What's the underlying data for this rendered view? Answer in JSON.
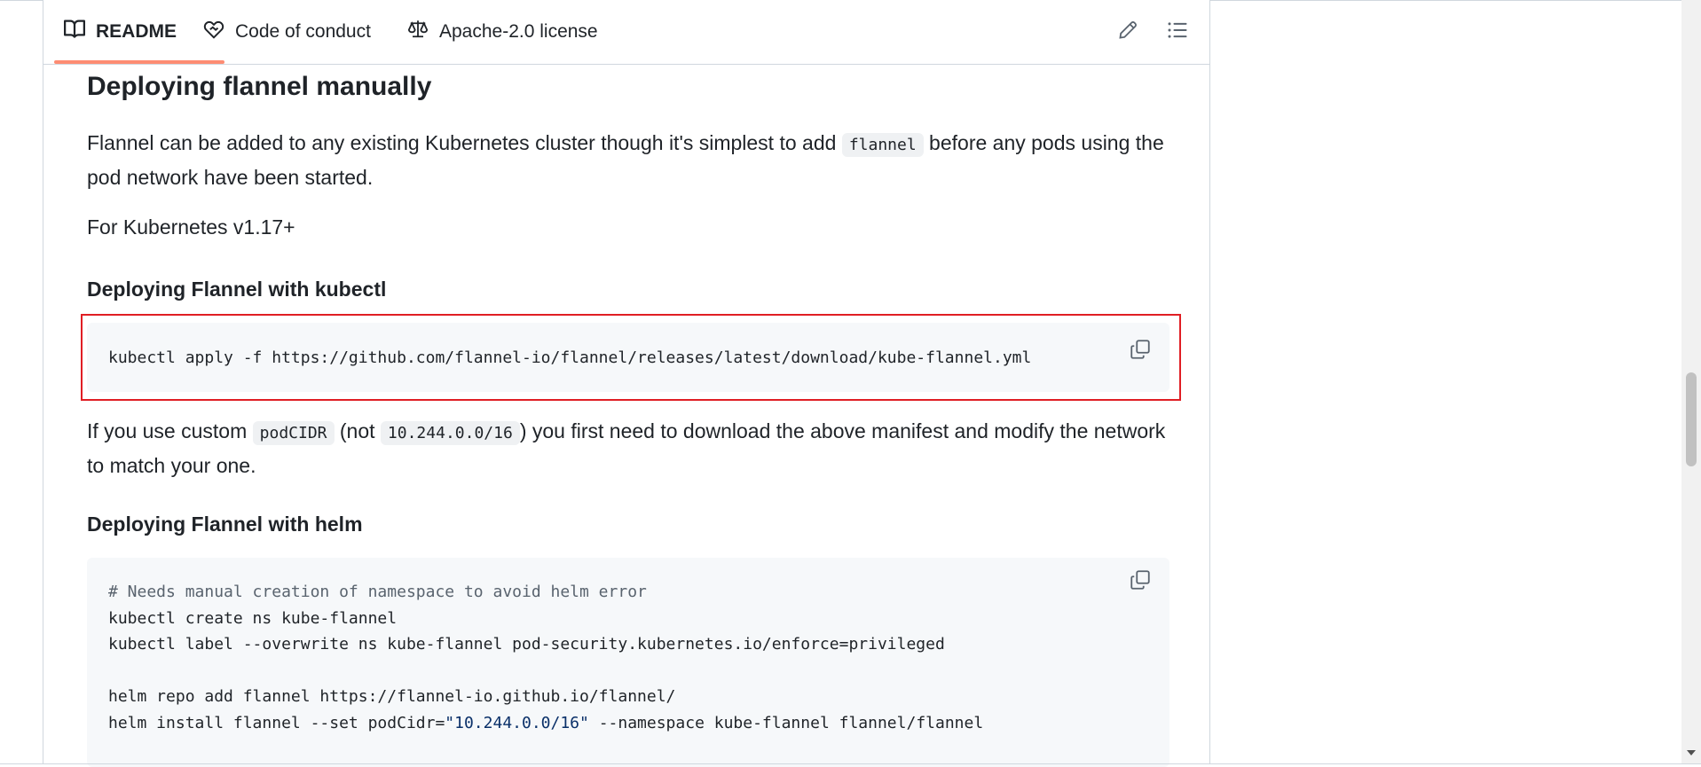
{
  "tabs": [
    {
      "label": "README",
      "icon": "book-icon",
      "active": true
    },
    {
      "label": "Code of conduct",
      "icon": "code-of-conduct-icon",
      "active": false
    },
    {
      "label": "Apache-2.0 license",
      "icon": "law-icon",
      "active": false
    }
  ],
  "toolbar": {
    "edit_icon": "pencil-icon",
    "outline_icon": "list-unordered-icon"
  },
  "content": {
    "heading": "Deploying flannel manually",
    "intro": {
      "before": "Flannel can be added to any existing Kubernetes cluster though it's simplest to add ",
      "code": "flannel",
      "after": " before any pods using the pod network have been started."
    },
    "version_note": "For Kubernetes v1.17+",
    "kubectl_heading": "Deploying Flannel with kubectl",
    "kubectl_command": "kubectl apply -f https://github.com/flannel-io/flannel/releases/latest/download/kube-flannel.yml",
    "custom_note": {
      "part1": "If you use custom ",
      "code1": "podCIDR",
      "part2": " (not ",
      "code2": "10.244.0.0/16",
      "part3": ") you first need to download the above manifest and modify the network to match your one."
    },
    "helm_heading": "Deploying Flannel with helm",
    "helm_code": {
      "comment": "# Needs manual creation of namespace to avoid helm error",
      "line1": "kubectl create ns kube-flannel",
      "line2": "kubectl label --overwrite ns kube-flannel pod-security.kubernetes.io/enforce=privileged",
      "line3": "helm repo add flannel https://flannel-io.github.io/flannel/",
      "line4_a": "helm install flannel --set podCidr=",
      "line4_str": "\"10.244.0.0/16\"",
      "line4_b": " --namespace kube-flannel flannel/flannel"
    }
  },
  "colors": {
    "accent_underline": "#fd8c73",
    "highlight": "#e01e24",
    "code_bg": "#f6f8fa"
  }
}
